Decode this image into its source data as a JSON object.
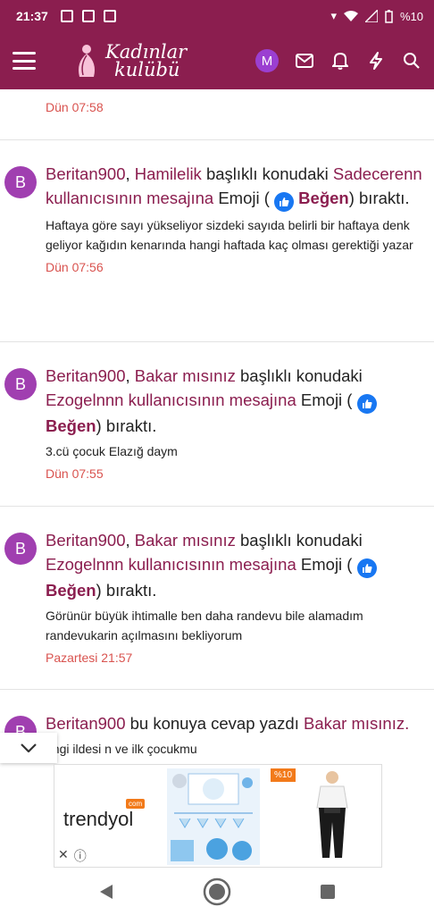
{
  "status_bar": {
    "time": "21:37",
    "battery": "%10"
  },
  "header": {
    "logo_line1": "Kadınlar",
    "logo_line2": "kulübü",
    "avatar_letter": "M"
  },
  "notifications": [
    {
      "time": "Dün 07:58"
    },
    {
      "avatar": "B",
      "user": "Beritan900",
      "thread": "Hamilelik",
      "mid": "başlıklı konudaki",
      "owner": "Sadecerenn kullanıcısının mesajına",
      "emoji_prefix": "Emoji (",
      "reaction": "Beğen",
      "suffix": ") bıraktı.",
      "snippet": "Haftaya göre sayı yükseliyor sizdeki sayıda belirli bir haftaya denk geliyor kağıdın kenarında hangi haftada kaç olması gerektiği yazar",
      "time": "Dün 07:56"
    },
    {
      "avatar": "B",
      "user": "Beritan900",
      "thread": "Bakar mısınız",
      "mid": "başlıklı konudaki",
      "owner": "Ezogelnnn kullanıcısının mesajına",
      "emoji_prefix": "Emoji (",
      "reaction": "Beğen",
      "suffix": ") bıraktı.",
      "snippet": "3.cü çocuk Elazığ daym",
      "time": "Dün 07:55"
    },
    {
      "avatar": "B",
      "user": "Beritan900",
      "thread": "Bakar mısınız",
      "mid": "başlıklı konudaki",
      "owner": "Ezogelnnn kullanıcısının mesajına",
      "emoji_prefix": "Emoji (",
      "reaction": "Beğen",
      "suffix": ") bıraktı.",
      "snippet": "Görünür büyük ihtimalle ben daha randevu bile alamadım randevukarin açılmasını bekliyorum",
      "time": "Pazartesi 21:57"
    },
    {
      "avatar": "B",
      "user": "Beritan900",
      "mid": "bu konuya cevap yazdı",
      "thread": "Bakar mısınız.",
      "snippet": "angi ildesi n ve ilk çocukmu"
    }
  ],
  "ad": {
    "brand": "trendyol",
    "brand_badge": "com",
    "discount": "%10"
  }
}
